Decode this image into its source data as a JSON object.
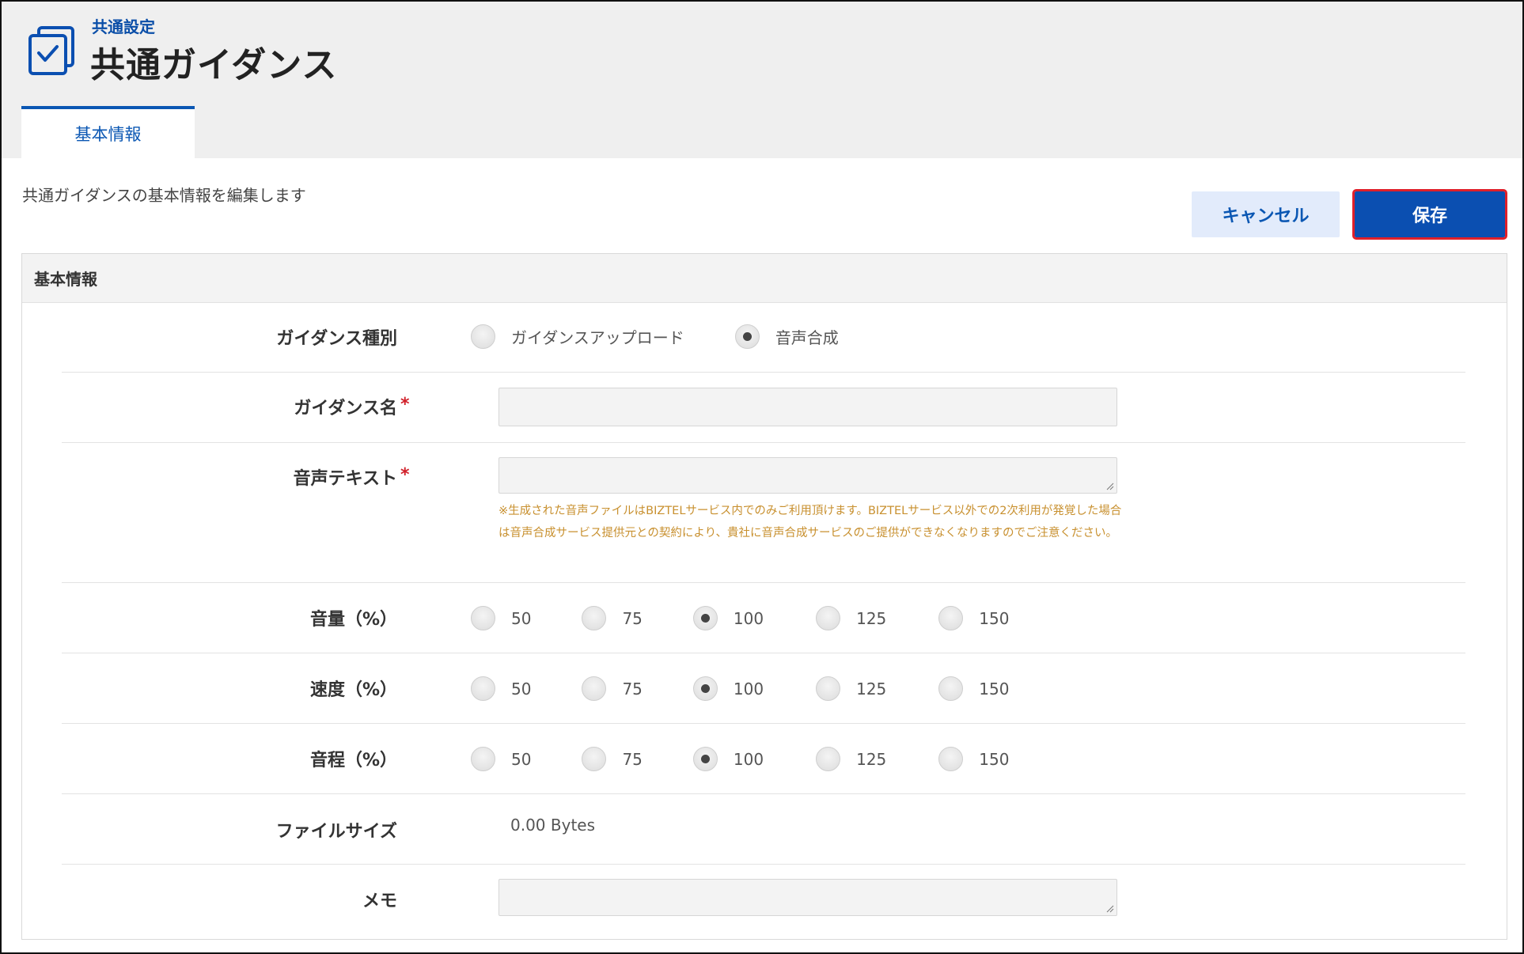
{
  "header": {
    "breadcrumb": "共通設定",
    "title": "共通ガイダンス",
    "tab_label": "基本情報"
  },
  "page": {
    "description": "共通ガイダンスの基本情報を編集します",
    "cancel_label": "キャンセル",
    "save_label": "保存"
  },
  "panel": {
    "title": "基本情報"
  },
  "form": {
    "guidance_type": {
      "label": "ガイダンス種別",
      "options": [
        "ガイダンスアップロード",
        "音声合成"
      ],
      "selected": "音声合成"
    },
    "guidance_name": {
      "label": "ガイダンス名",
      "required_mark": "*",
      "value": ""
    },
    "voice_text": {
      "label": "音声テキスト",
      "required_mark": "*",
      "value": "",
      "note": "※生成された音声ファイルはBIZTELサービス内でのみご利用頂けます。BIZTELサービス以外での2次利用が発覚した場合は音声合成サービス提供元との契約により、貴社に音声合成サービスのご提供ができなくなりますのでご注意ください。"
    },
    "volume": {
      "label": "音量（%）",
      "options": [
        "50",
        "75",
        "100",
        "125",
        "150"
      ],
      "selected": "100"
    },
    "speed": {
      "label": "速度（%）",
      "options": [
        "50",
        "75",
        "100",
        "125",
        "150"
      ],
      "selected": "100"
    },
    "pitch": {
      "label": "音程（%）",
      "options": [
        "50",
        "75",
        "100",
        "125",
        "150"
      ],
      "selected": "100"
    },
    "file_size": {
      "label": "ファイルサイズ",
      "value": "0.00 Bytes"
    },
    "memo": {
      "label": "メモ",
      "value": ""
    }
  },
  "colors": {
    "accent": "#0b57b3",
    "save_button": "#0b4fb1",
    "highlight_outline": "#e0202a",
    "required": "#d1202a",
    "note": "#c8902f"
  },
  "icons": {
    "app_icon": "checkbox-document-icon",
    "resize_handle": "resize-handle-icon"
  }
}
